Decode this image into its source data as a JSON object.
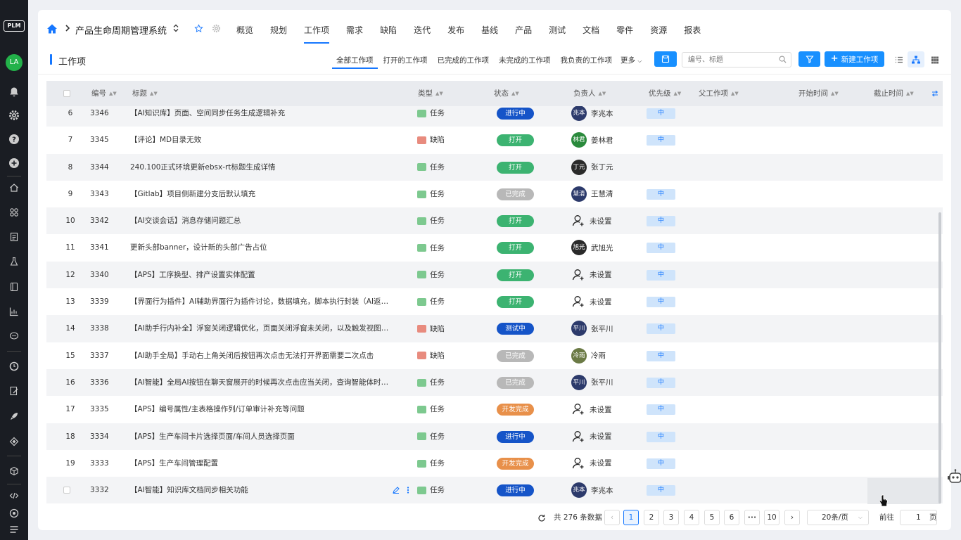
{
  "app": {
    "logo": "PLM",
    "user_initials": "LA"
  },
  "nav": {
    "project": "产品生命周期管理系统",
    "tabs": [
      "概览",
      "规划",
      "工作项",
      "需求",
      "缺陷",
      "迭代",
      "发布",
      "基线",
      "产品",
      "测试",
      "文档",
      "零件",
      "资源",
      "报表"
    ],
    "active_tab": "工作项"
  },
  "sub": {
    "title": "工作项",
    "views": [
      "全部工作项",
      "打开的工作项",
      "已完成的工作项",
      "未完成的工作项",
      "我负责的工作项"
    ],
    "active_view": "全部工作项",
    "more": "更多",
    "search_placeholder": "编号、标题",
    "new_button": "新建工作项"
  },
  "table": {
    "headers": {
      "id": "编号",
      "title": "标题",
      "type": "类型",
      "status": "状态",
      "assignee": "负责人",
      "priority": "优先级",
      "parent": "父工作项",
      "start": "开始时间",
      "due": "截止时间"
    },
    "rows": [
      {
        "no": "6",
        "id": "3346",
        "title": "【AI知识库】页面、空间同步任务生成逻辑补充",
        "type": "任务",
        "type_kind": "task",
        "status": "进行中",
        "status_kind": "s-run",
        "avatar": "兆本",
        "avatar_color": "#2c3a6b",
        "assignee": "李兆本",
        "priority": "中"
      },
      {
        "no": "7",
        "id": "3345",
        "title": "【评论】MD目录无效",
        "type": "缺陷",
        "type_kind": "bug",
        "status": "打开",
        "status_kind": "s-open",
        "avatar": "林君",
        "avatar_color": "#2a8a3c",
        "assignee": "姜林君",
        "priority": "中"
      },
      {
        "no": "8",
        "id": "3344",
        "title": "240.100正式环境更新ebsx-rt标题生成详情",
        "type": "任务",
        "type_kind": "task",
        "status": "打开",
        "status_kind": "s-open",
        "avatar": "丁元",
        "avatar_color": "#2a2a2a",
        "assignee": "张丁元",
        "priority": ""
      },
      {
        "no": "9",
        "id": "3343",
        "title": "【Gitlab】项目侧新建分支后默认填充",
        "type": "任务",
        "type_kind": "task",
        "status": "已完成",
        "status_kind": "s-done",
        "avatar": "慧清",
        "avatar_color": "#2c3a6b",
        "assignee": "王慧清",
        "priority": "中"
      },
      {
        "no": "10",
        "id": "3342",
        "title": "【AI交谈会话】消息存储问题汇总",
        "type": "任务",
        "type_kind": "task",
        "status": "打开",
        "status_kind": "s-open",
        "avatar": "",
        "avatar_color": "",
        "assignee": "未设置",
        "priority": "中"
      },
      {
        "no": "11",
        "id": "3341",
        "title": "更新头部banner，设计新的头部广告占位",
        "type": "任务",
        "type_kind": "task",
        "status": "打开",
        "status_kind": "s-open",
        "avatar": "旭光",
        "avatar_color": "#2a2a2a",
        "assignee": "武旭光",
        "priority": "中"
      },
      {
        "no": "12",
        "id": "3340",
        "title": "【APS】工序换型、排产设置实体配置",
        "type": "任务",
        "type_kind": "task",
        "status": "打开",
        "status_kind": "s-open",
        "avatar": "",
        "avatar_color": "",
        "assignee": "未设置",
        "priority": "中"
      },
      {
        "no": "13",
        "id": "3339",
        "title": "【界面行为插件】AI辅助界面行为插件讨论，数据填充，脚本执行封装（AI返回）",
        "type": "任务",
        "type_kind": "task",
        "status": "打开",
        "status_kind": "s-open",
        "avatar": "",
        "avatar_color": "",
        "assignee": "未设置",
        "priority": "中"
      },
      {
        "no": "14",
        "id": "3338",
        "title": "【AI助手行内补全】浮窗关闭逻辑优化，页面关闭浮窗未关闭，以及触发视图数…",
        "type": "缺陷",
        "type_kind": "bug",
        "status": "测试中",
        "status_kind": "s-test",
        "avatar": "平川",
        "avatar_color": "#2c3a6b",
        "assignee": "张平川",
        "priority": "中"
      },
      {
        "no": "15",
        "id": "3337",
        "title": "【AI助手全局】手动右上角关闭后按钮再次点击无法打开界面需要二次点击",
        "type": "缺陷",
        "type_kind": "bug",
        "status": "已完成",
        "status_kind": "s-done",
        "avatar": "冷雨",
        "avatar_color": "#6b7a45",
        "assignee": "冷雨",
        "priority": "中"
      },
      {
        "no": "16",
        "id": "3336",
        "title": "【AI智能】全局AI按钮在聊天窗展开的时候再次点击应当关闭，查询智能体时应当…",
        "type": "任务",
        "type_kind": "task",
        "status": "已完成",
        "status_kind": "s-done",
        "avatar": "平川",
        "avatar_color": "#2c3a6b",
        "assignee": "张平川",
        "priority": "中"
      },
      {
        "no": "17",
        "id": "3335",
        "title": "【APS】编号属性/主表格操作列/订单审计补充等问题",
        "type": "任务",
        "type_kind": "task",
        "status": "开发完成",
        "status_kind": "s-dev",
        "avatar": "",
        "avatar_color": "",
        "assignee": "未设置",
        "priority": "中"
      },
      {
        "no": "18",
        "id": "3334",
        "title": "【APS】生产车间卡片选择页面/车间人员选择页面",
        "type": "任务",
        "type_kind": "task",
        "status": "进行中",
        "status_kind": "s-run",
        "avatar": "",
        "avatar_color": "",
        "assignee": "未设置",
        "priority": "中"
      },
      {
        "no": "19",
        "id": "3333",
        "title": "【APS】生产车间管理配置",
        "type": "任务",
        "type_kind": "task",
        "status": "开发完成",
        "status_kind": "s-dev",
        "avatar": "",
        "avatar_color": "",
        "assignee": "未设置",
        "priority": "中"
      },
      {
        "no": "",
        "id": "3332",
        "title": "【AI智能】知识库文档同步相关功能",
        "type": "任务",
        "type_kind": "task",
        "status": "进行中",
        "status_kind": "s-run",
        "avatar": "兆本",
        "avatar_color": "#2c3a6b",
        "assignee": "李兆本",
        "priority": "中"
      }
    ]
  },
  "pager": {
    "total": "共 276 条数据",
    "pages": [
      "1",
      "2",
      "3",
      "4",
      "5",
      "6",
      "10"
    ],
    "active_page": "1",
    "ellipsis": "•••",
    "page_size": "20条/页",
    "goto_label": "前往",
    "goto_value": "1",
    "page_unit": "页"
  },
  "colors": {
    "accent": "#1677ff",
    "rail": "#1a1d23"
  }
}
